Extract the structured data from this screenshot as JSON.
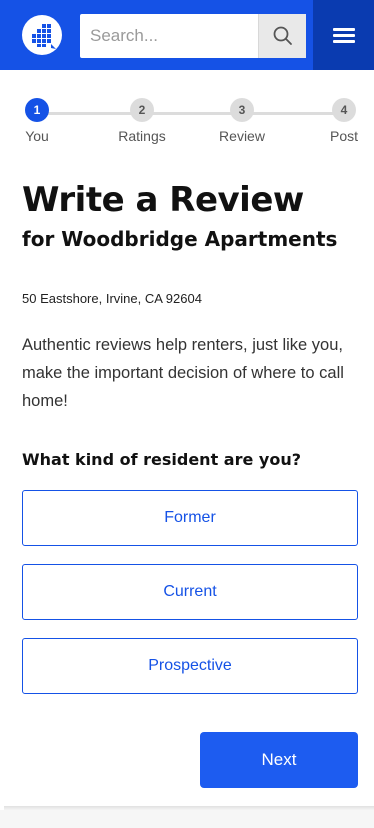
{
  "header": {
    "logo_icon": "building-logo-icon",
    "search_placeholder": "Search...",
    "search_icon": "magnifier-icon",
    "menu_icon": "hamburger-menu-icon",
    "brand_color": "#1552e6",
    "menu_bg_color": "#0a3bb0"
  },
  "stepper": {
    "active_step": 1,
    "steps": [
      {
        "number": "1",
        "label": "You"
      },
      {
        "number": "2",
        "label": "Ratings"
      },
      {
        "number": "3",
        "label": "Review"
      },
      {
        "number": "4",
        "label": "Post"
      }
    ]
  },
  "main": {
    "title": "Write a Review",
    "subtitle": "for Woodbridge Apartments",
    "address": "50 Eastshore, Irvine, CA 92604",
    "intro": "Authentic reviews help renters, just like you, make the important decision of where to call home!",
    "question": "What kind of resident are you?",
    "options": [
      "Former",
      "Current",
      "Prospective"
    ],
    "next_label": "Next"
  }
}
